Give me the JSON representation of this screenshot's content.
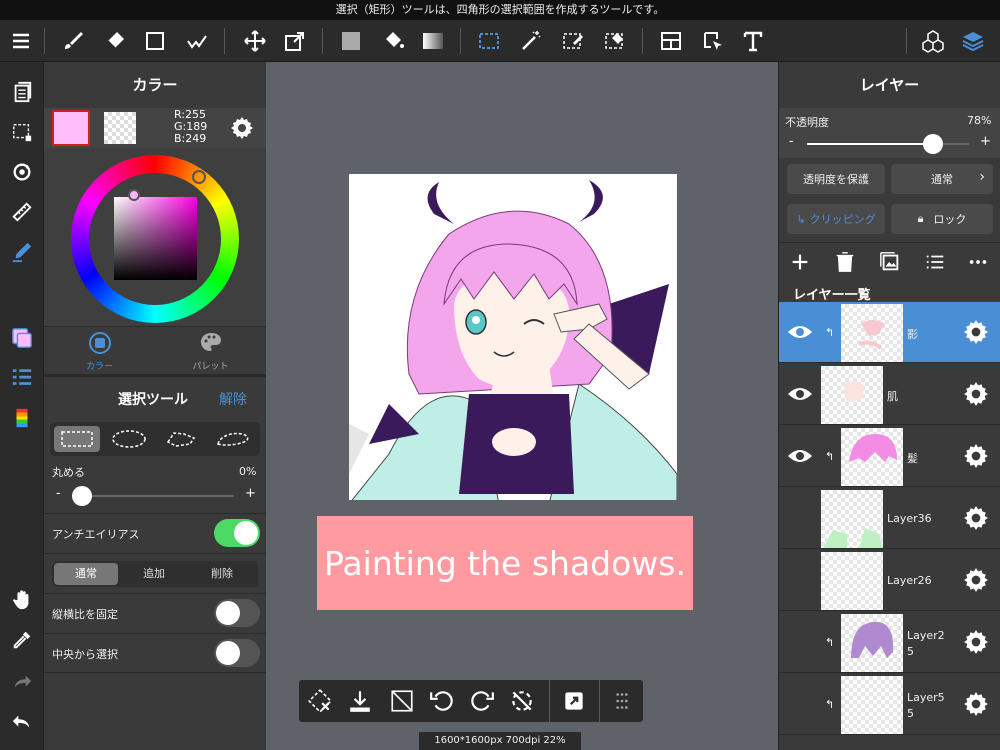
{
  "tip": "選択（矩形）ツールは、四角形の選択範囲を作成するツールです。",
  "color_panel": {
    "title": "カラー",
    "rgb": {
      "r": "R:255",
      "g": "G:189",
      "b": "B:249"
    },
    "tabs": [
      "カラー",
      "パレット"
    ],
    "primary_color": "#ffbdf9"
  },
  "select_tool": {
    "title": "選択ツール",
    "cancel": "解除",
    "round_label": "丸める",
    "round_value": "0%",
    "minus": "-",
    "plus": "+",
    "antialias_label": "アンチエイリアス",
    "antialias_on": true,
    "modes": [
      "通常",
      "追加",
      "削除"
    ],
    "fix_ratio_label": "縦横比を固定",
    "from_center_label": "中央から選択"
  },
  "canvas": {
    "caption": "Painting the shadows.",
    "status": "1600*1600px 700dpi 22%"
  },
  "layer_panel": {
    "title": "レイヤー",
    "opacity_label": "不透明度",
    "opacity_value": "78%",
    "opacity_fraction": 0.78,
    "minus": "-",
    "plus": "+",
    "protect_alpha": "透明度を保護",
    "blend_mode": "通常",
    "clipping": "クリッピング",
    "lock": "ロック",
    "list_title": "レイヤー一覧",
    "layers": [
      {
        "name": "影"
      },
      {
        "name": "肌"
      },
      {
        "name": "髪"
      },
      {
        "name": "Layer36"
      },
      {
        "name": "Layer26"
      },
      {
        "name": "Layer2\n5"
      },
      {
        "name": "Layer5\n5"
      }
    ]
  },
  "colors": {
    "accent": "#4a90d9",
    "toggle_on": "#4cd964",
    "caption_bg": "#ff9aa0",
    "selected_layer": "#4a8fd6"
  }
}
